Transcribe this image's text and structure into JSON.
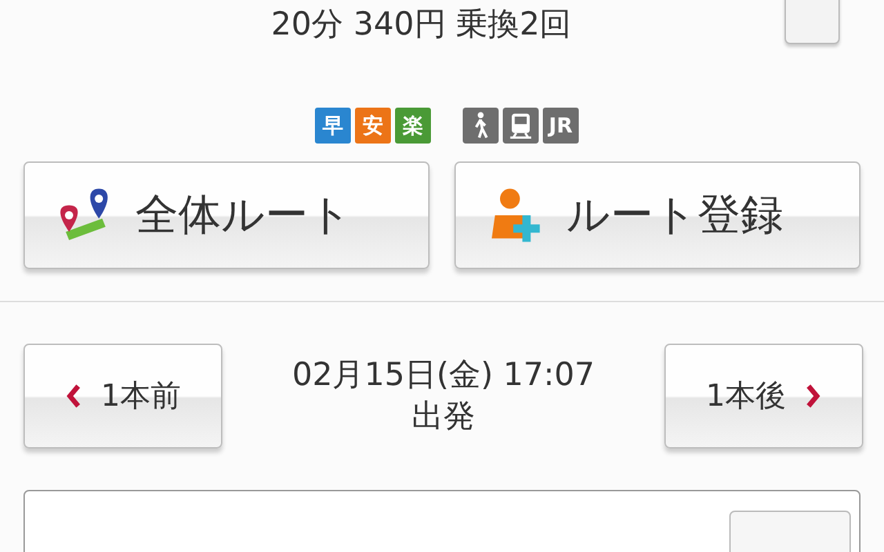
{
  "summary": "20分 340円 乗換2回",
  "badges": [
    {
      "kind": "label",
      "text": "早",
      "color": "#2a86d0"
    },
    {
      "kind": "label",
      "text": "安",
      "color": "#ec7417"
    },
    {
      "kind": "label",
      "text": "楽",
      "color": "#4a9a36"
    },
    {
      "kind": "walk"
    },
    {
      "kind": "train"
    },
    {
      "kind": "label",
      "text": "JR",
      "color": "#6e6e6e"
    }
  ],
  "actions": [
    {
      "kind": "map",
      "label": "全体ルート"
    },
    {
      "kind": "register",
      "label": "ルート登録"
    }
  ],
  "nav": {
    "prev": "1本前",
    "datetime": "02月15日(金) 17:07",
    "mode": "出発",
    "next": "1本後"
  }
}
